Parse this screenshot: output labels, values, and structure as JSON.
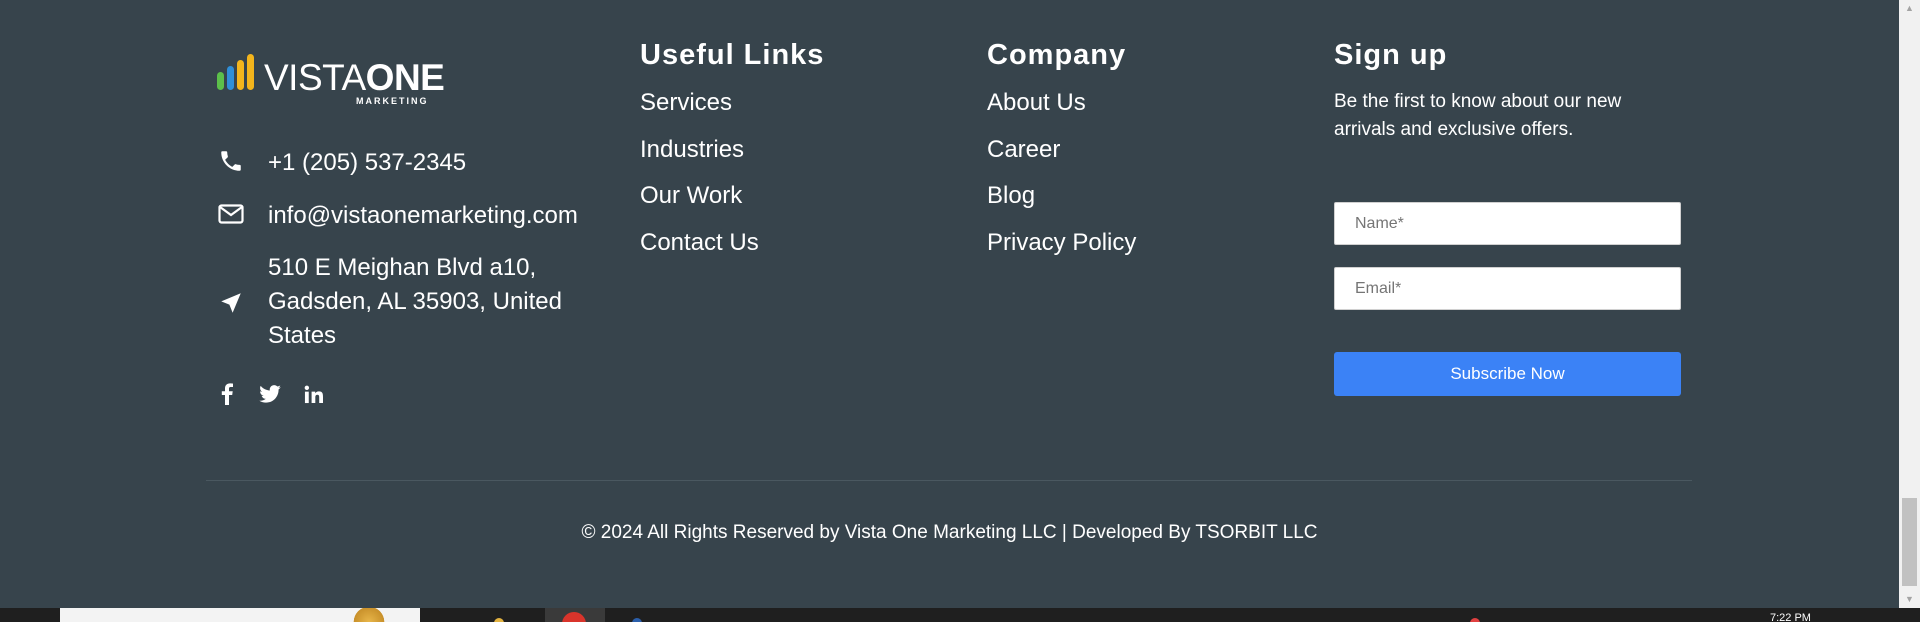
{
  "logo": {
    "text_thin": "VISTA",
    "text_bold": "ONE",
    "subtext": "MARKETING"
  },
  "contact": {
    "phone": "+1 (205) 537-2345",
    "email": "info@vistaonemarketing.com",
    "address": "510 E Meighan Blvd a10, Gadsden, AL 35903, United States"
  },
  "social_icons": [
    "facebook-icon",
    "twitter-icon",
    "linkedin-icon"
  ],
  "useful_links": {
    "title": "Useful Links",
    "items": [
      "Services",
      "Industries",
      "Our Work",
      "Contact Us"
    ]
  },
  "company": {
    "title": "Company",
    "items": [
      "About Us",
      "Career",
      "Blog",
      "Privacy Policy"
    ]
  },
  "signup": {
    "title": "Sign up",
    "text": "Be the first to know about our new arrivals and exclusive offers.",
    "name_placeholder": "Name*",
    "email_placeholder": "Email*",
    "button_label": "Subscribe Now"
  },
  "copyright": "© 2024 All Rights Reserved by Vista One Marketing LLC | Developed By TSORBIT LLC",
  "taskbar": {
    "clock": "7:22 PM"
  },
  "colors": {
    "footer_bg": "#37444c",
    "button_blue": "#3b82f6",
    "logo_green": "#5cc04a",
    "logo_blue": "#2f8fd8",
    "logo_yellow": "#f3b51c"
  }
}
